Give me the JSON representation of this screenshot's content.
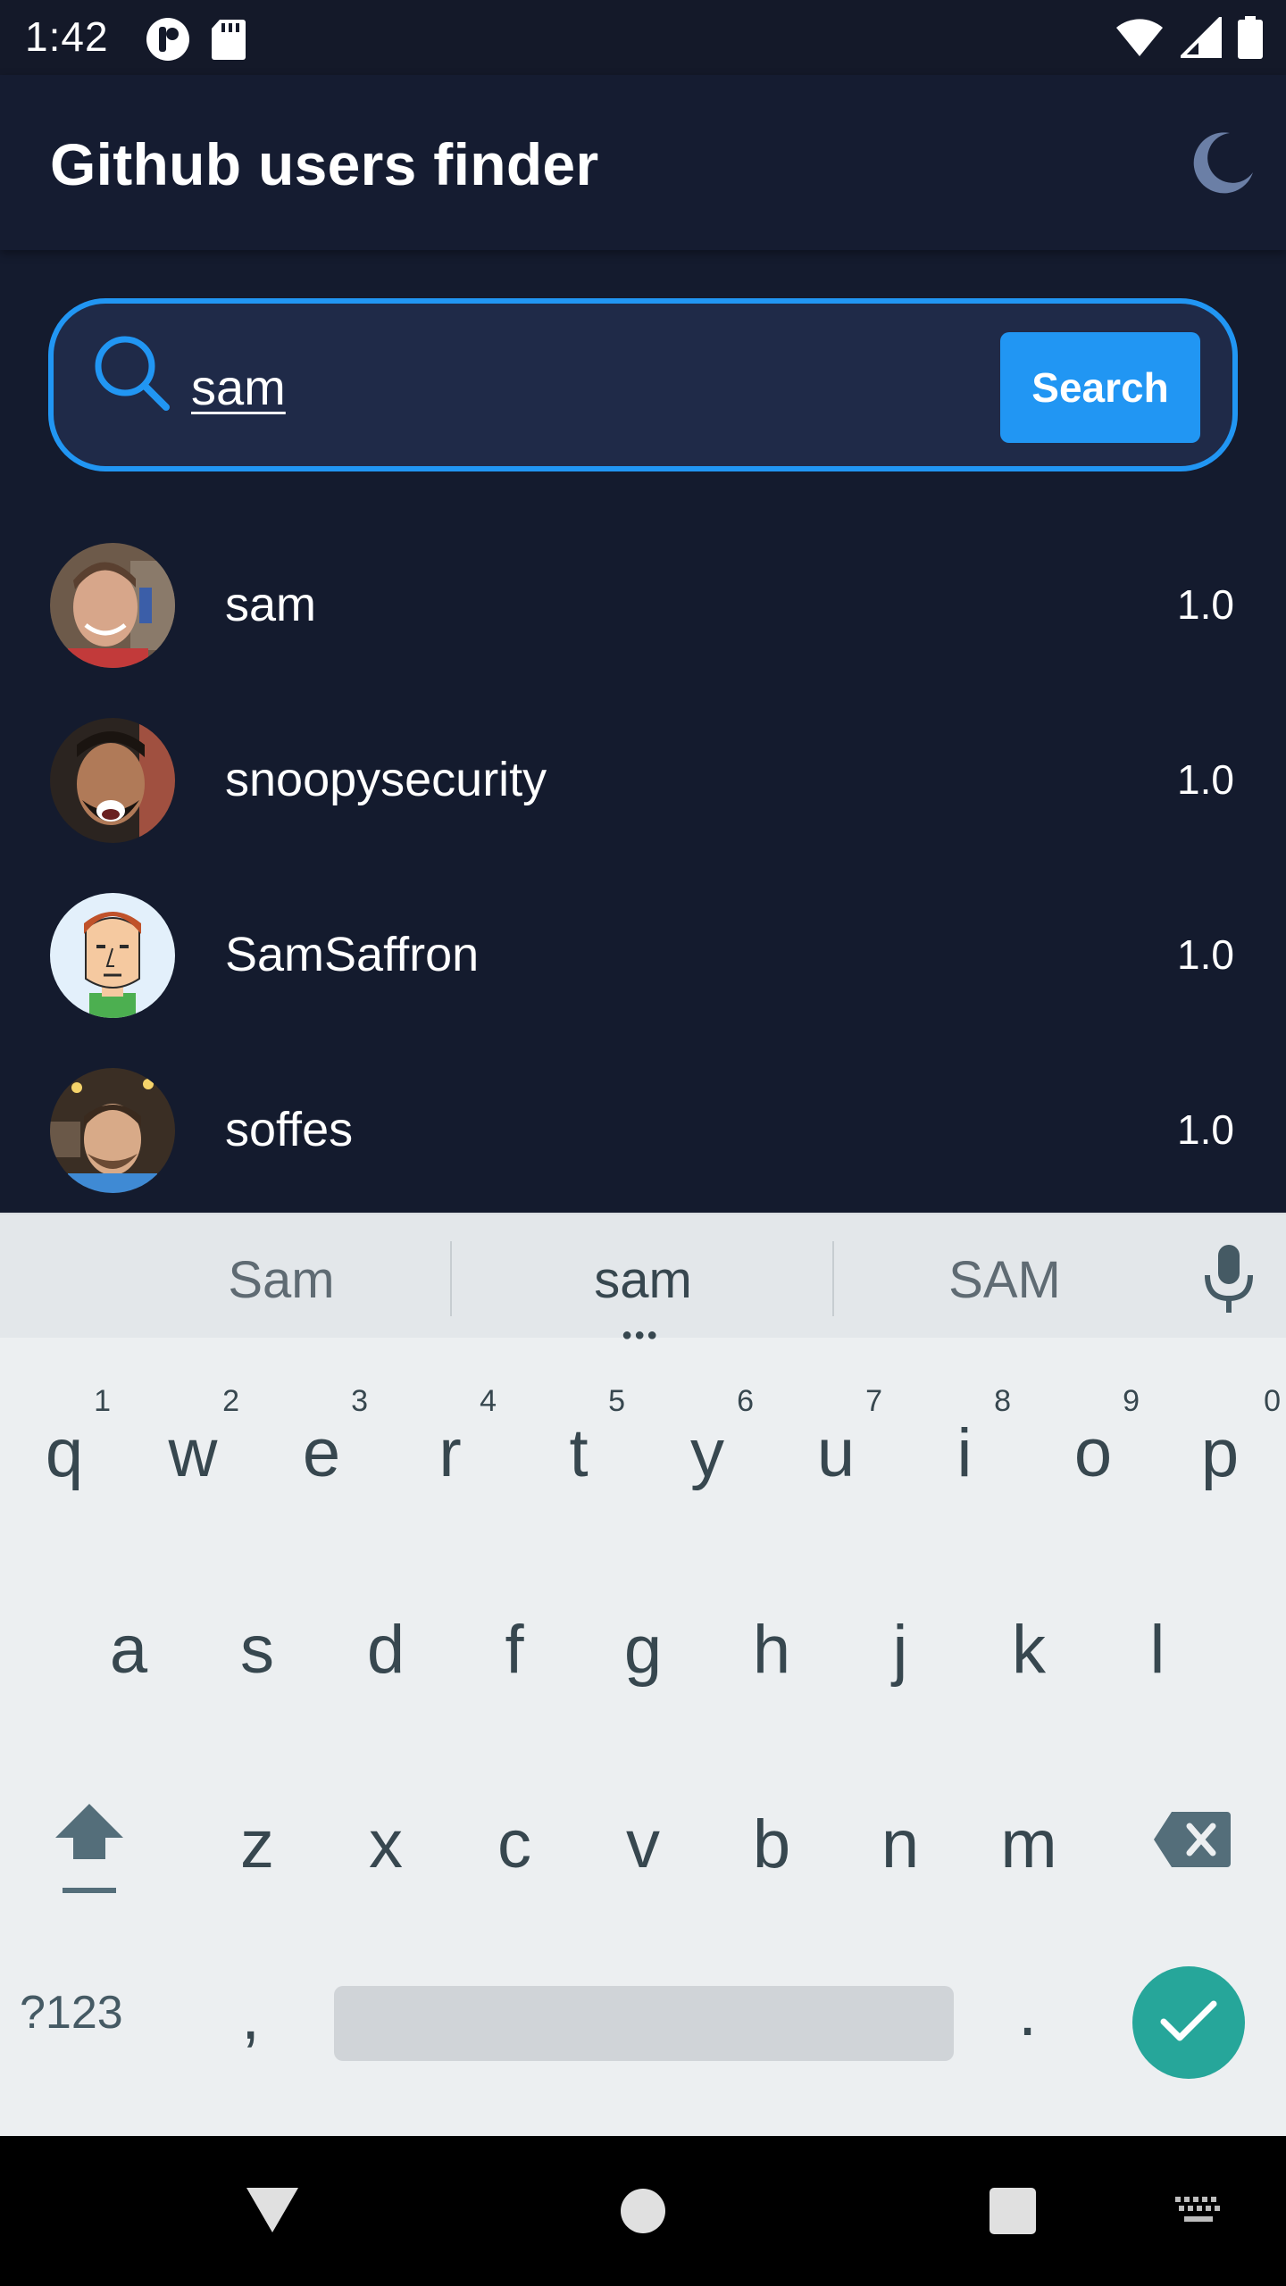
{
  "status_bar": {
    "time": "1:42"
  },
  "app_bar": {
    "title": "Github users finder",
    "theme_icon": "moon-icon"
  },
  "search": {
    "value": "sam",
    "button_label": "Search",
    "accent_color": "#2196f3"
  },
  "results": [
    {
      "name": "sam",
      "score": "1.0"
    },
    {
      "name": "snoopysecurity",
      "score": "1.0"
    },
    {
      "name": "SamSaffron",
      "score": "1.0"
    },
    {
      "name": "soffes",
      "score": "1.0"
    }
  ],
  "keyboard": {
    "suggestions": [
      "Sam",
      "sam",
      "SAM"
    ],
    "row1": [
      {
        "key": "q",
        "hint": "1"
      },
      {
        "key": "w",
        "hint": "2"
      },
      {
        "key": "e",
        "hint": "3"
      },
      {
        "key": "r",
        "hint": "4"
      },
      {
        "key": "t",
        "hint": "5"
      },
      {
        "key": "y",
        "hint": "6"
      },
      {
        "key": "u",
        "hint": "7"
      },
      {
        "key": "i",
        "hint": "8"
      },
      {
        "key": "o",
        "hint": "9"
      },
      {
        "key": "p",
        "hint": "0"
      }
    ],
    "row2": [
      "a",
      "s",
      "d",
      "f",
      "g",
      "h",
      "j",
      "k",
      "l"
    ],
    "row3": [
      "z",
      "x",
      "c",
      "v",
      "b",
      "n",
      "m"
    ],
    "symbols_label": "?123",
    "comma_label": ",",
    "period_label": ".",
    "enter_color": "#26a69a"
  }
}
